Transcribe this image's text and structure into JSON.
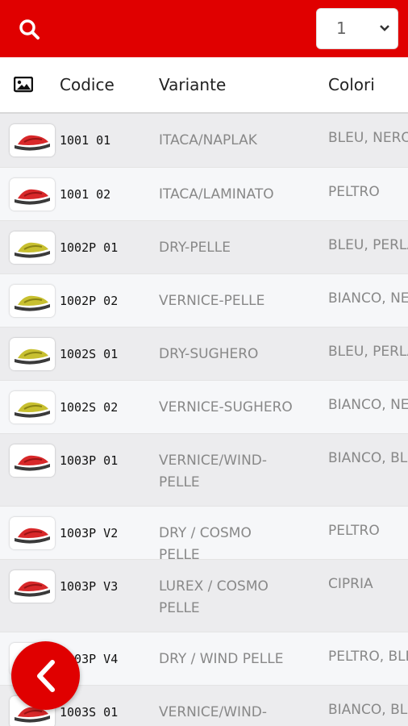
{
  "header": {
    "page_select_value": "1"
  },
  "table": {
    "columns": {
      "image": "",
      "code": "Codice",
      "variant": "Variante",
      "colors": "Colori"
    },
    "rows": [
      {
        "code": "1001 01",
        "variant": "ITACA/NAPLAK",
        "colors": "BLEU, NERO",
        "shoe": "red"
      },
      {
        "code": "1001 02",
        "variant": "ITACA/LAMINATO",
        "colors": "PELTRO",
        "shoe": "red"
      },
      {
        "code": "1002P 01",
        "variant": "DRY-PELLE",
        "colors": "BLEU, PERLA",
        "shoe": "yellow"
      },
      {
        "code": "1002P 02",
        "variant": "VERNICE-PELLE",
        "colors": "BIANCO, NE",
        "shoe": "yellow"
      },
      {
        "code": "1002S 01",
        "variant": "DRY-SUGHERO",
        "colors": "BLEU, PERLA",
        "shoe": "yellow"
      },
      {
        "code": "1002S 02",
        "variant": "VERNICE-SUGHERO",
        "colors": "BIANCO, NE",
        "shoe": "yellow"
      },
      {
        "code": "1003P 01",
        "variant": "VERNICE/WIND-PELLE",
        "colors": "BIANCO, BL",
        "shoe": "red"
      },
      {
        "code": "1003P V2",
        "variant": "DRY / COSMO PELLE",
        "colors": "PELTRO",
        "shoe": "red"
      },
      {
        "code": "1003P V3",
        "variant": "LUREX / COSMO PELLE",
        "colors": "CIPRIA",
        "shoe": "red"
      },
      {
        "code": "1003P V4",
        "variant": "DRY / WIND PELLE",
        "colors": "PELTRO, BLE",
        "shoe": "red"
      },
      {
        "code": "1003S 01",
        "variant": "VERNICE/WIND-SUGHERO",
        "colors": "BIANCO, BL",
        "shoe": "red"
      }
    ]
  },
  "colors": {
    "accent": "#e00000",
    "row_odd": "#ececee",
    "row_even": "#f6f7f9"
  },
  "icons": {
    "search": "search-icon",
    "image": "image-icon",
    "dropdown": "chevron-down-icon",
    "back": "chevron-left-icon"
  }
}
